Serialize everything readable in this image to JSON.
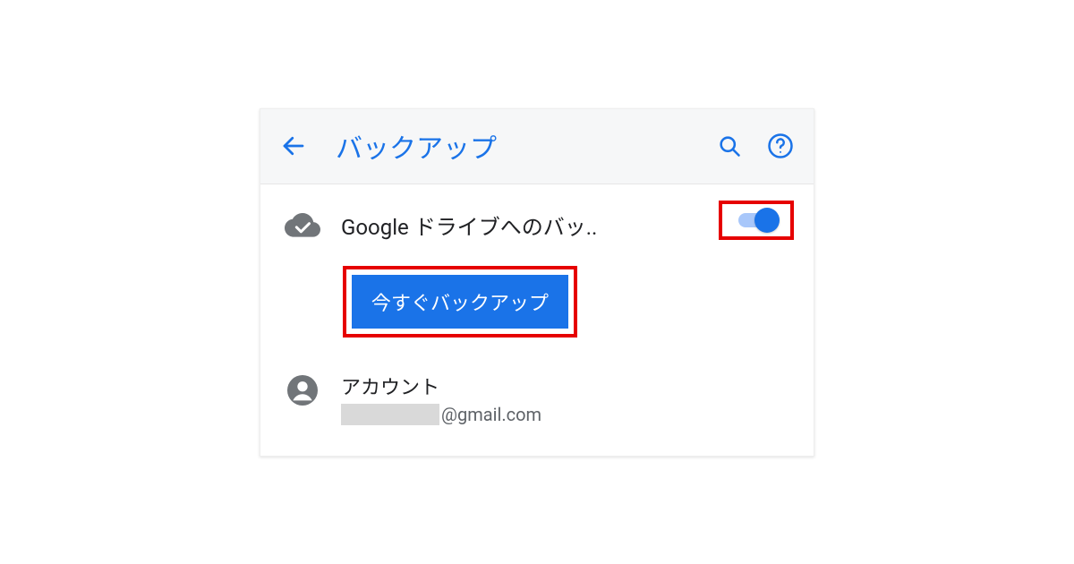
{
  "header": {
    "title": "バックアップ"
  },
  "backup": {
    "setting_label": "Google ドライブへのバッ..",
    "toggle_on": true,
    "button_label": "今すぐバックアップ"
  },
  "account": {
    "label": "アカウント",
    "email_suffix": "@gmail.com"
  },
  "colors": {
    "accent": "#1a73e8",
    "highlight_border": "#e60000"
  }
}
